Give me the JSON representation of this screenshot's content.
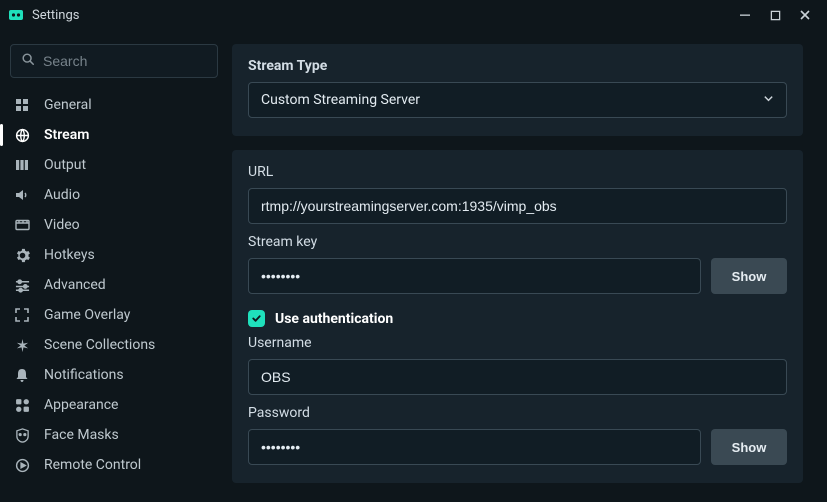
{
  "window": {
    "title": "Settings"
  },
  "search": {
    "placeholder": "Search"
  },
  "sidebar": {
    "items": [
      {
        "key": "general",
        "label": "General"
      },
      {
        "key": "stream",
        "label": "Stream"
      },
      {
        "key": "output",
        "label": "Output"
      },
      {
        "key": "audio",
        "label": "Audio"
      },
      {
        "key": "video",
        "label": "Video"
      },
      {
        "key": "hotkeys",
        "label": "Hotkeys"
      },
      {
        "key": "advanced",
        "label": "Advanced"
      },
      {
        "key": "game-overlay",
        "label": "Game Overlay"
      },
      {
        "key": "scene-collections",
        "label": "Scene Collections"
      },
      {
        "key": "notifications",
        "label": "Notifications"
      },
      {
        "key": "appearance",
        "label": "Appearance"
      },
      {
        "key": "face-masks",
        "label": "Face Masks"
      },
      {
        "key": "remote-control",
        "label": "Remote Control"
      }
    ],
    "active": "stream"
  },
  "stream": {
    "type_label": "Stream Type",
    "type_value": "Custom Streaming Server",
    "url_label": "URL",
    "url_value": "rtmp://yourstreamingserver.com:1935/vimp_obs",
    "key_label": "Stream key",
    "key_value": "••••••••",
    "show_label": "Show",
    "auth_label": "Use authentication",
    "auth_checked": true,
    "username_label": "Username",
    "username_value": "OBS",
    "password_label": "Password",
    "password_value": "••••••••"
  },
  "colors": {
    "accent": "#1fe0bc"
  }
}
